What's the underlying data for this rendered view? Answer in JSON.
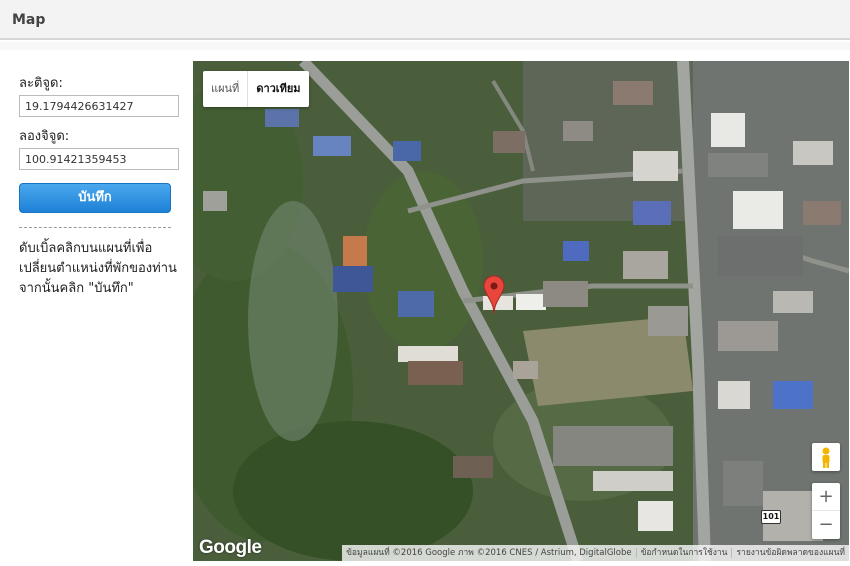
{
  "header": {
    "title": "Map"
  },
  "sidebar": {
    "lat_label": "ละติจูด:",
    "lat_value": "19.1794426631427",
    "lng_label": "ลองจิจูด:",
    "lng_value": "100.91421359453",
    "save_label": "บันทึก",
    "help_text": "ดับเบิ้ลคลิกบนแผนที่เพื่อเปลี่ยนตำแหน่งที่พักของท่านจากนั้นคลิก \"บันทึก\""
  },
  "map": {
    "type_map_label": "แผนที่",
    "type_satellite_label": "ดาวเทียม",
    "active_type": "satellite",
    "zoom_in_label": "+",
    "zoom_out_label": "−",
    "logo": "Google",
    "road_shield": "101",
    "attribution": {
      "data": "ข้อมูลแผนที่ ©2016 Google ภาพ ©2016 CNES / Astrium, DigitalGlobe",
      "terms": "ข้อกำหนดในการใช้งาน",
      "report": "รายงานข้อผิดพลาดของแผนที่"
    },
    "marker_color": "#e8453c",
    "pegman_icon": "pegman-icon",
    "marker_icon": "map-pin-icon"
  },
  "colors": {
    "accent": "#1e81d6",
    "header_bg": "#f3f3f3"
  }
}
